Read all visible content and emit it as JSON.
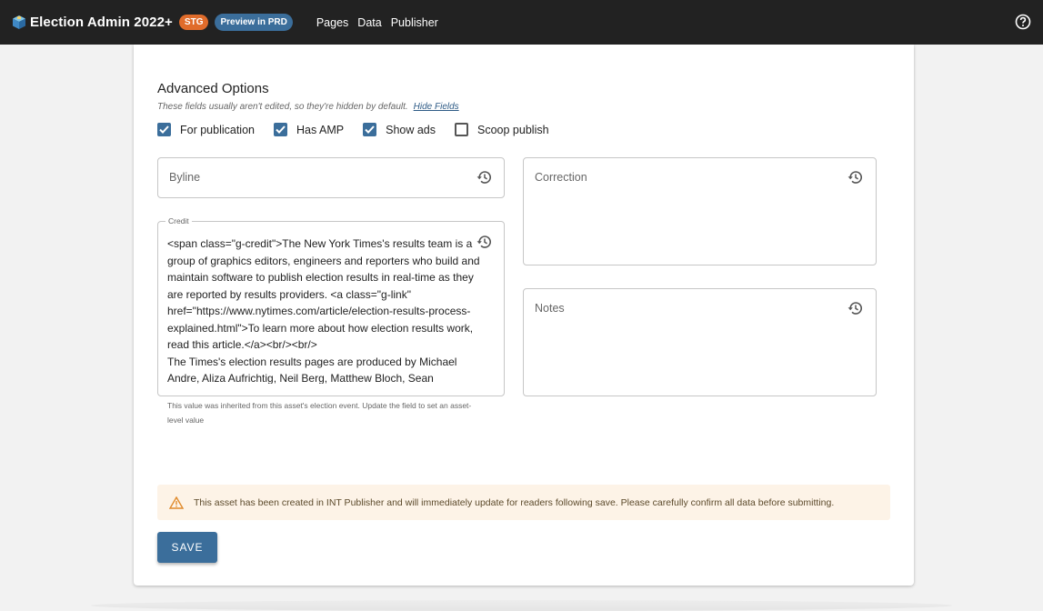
{
  "header": {
    "title": "Election Admin 2022+",
    "env_badge": "STG",
    "preview_button": "Preview in PRD",
    "nav": [
      "Pages",
      "Data",
      "Publisher"
    ],
    "help_icon": "help-circle-icon"
  },
  "advanced": {
    "title": "Advanced Options",
    "subtitle": "These fields usually aren't edited, so they're hidden by default.",
    "hide_link": "Hide Fields",
    "checkboxes": [
      {
        "label": "For publication",
        "checked": true
      },
      {
        "label": "Has AMP",
        "checked": true
      },
      {
        "label": "Show ads",
        "checked": true
      },
      {
        "label": "Scoop publish",
        "checked": false
      }
    ]
  },
  "fields": {
    "byline": {
      "label": "Byline"
    },
    "correction": {
      "label": "Correction"
    },
    "notes": {
      "label": "Notes"
    },
    "credit": {
      "label": "Credit",
      "value": "<span class=\"g-credit\">The New York Times's results team is a group of graphics editors, engineers and reporters who build and maintain software to publish election results in real-time as they are reported by results providers. <a class=\"g-link\" href=\"https://www.nytimes.com/article/election-results-process-explained.html\">To learn more about how election results work, read this article.</a><br/><br/>\nThe Times's election results pages are produced by Michael Andre, Aliza Aufrichtig, Neil Berg, Matthew Bloch, Sean",
      "helper": "This value was inherited from this asset's election event. Update the field to set an asset-level value"
    }
  },
  "alert": {
    "text": "This asset has been created in INT Publisher and will immediately update for readers following save. Please carefully confirm all data before submitting.",
    "icon": "warning-icon"
  },
  "save_label": "SAVE",
  "colors": {
    "topbar": "#222222",
    "stg_badge": "#e06c2b",
    "prd_badge": "#3b6e9b",
    "checkbox": "#3b6e9b",
    "save_button": "#3b6e9b",
    "alert_bg": "#fdf3e7"
  }
}
